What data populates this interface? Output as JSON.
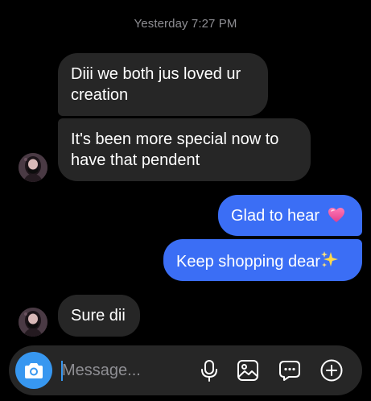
{
  "header": {
    "timestamp": "Yesterday 7:27 PM"
  },
  "messages": [
    {
      "from": "them",
      "text": "Diii we both jus loved ur creation"
    },
    {
      "from": "them",
      "text": "It's been more special now to have that pendent"
    },
    {
      "from": "me",
      "text": "Glad to hear",
      "emoji": "pink-heart"
    },
    {
      "from": "me",
      "text": "Keep shopping dear",
      "emoji": "sparkles"
    },
    {
      "from": "them",
      "text": "Sure dii"
    }
  ],
  "composer": {
    "placeholder": "Message...",
    "icons": [
      "camera-icon",
      "microphone-icon",
      "image-icon",
      "sticker-chat-icon",
      "plus-circle-icon"
    ]
  },
  "colors": {
    "background": "#000000",
    "incoming_bubble": "#262626",
    "outgoing_bubble": "#3b6ef5",
    "camera_button": "#3797f0",
    "timestamp_text": "#8e8e93"
  }
}
